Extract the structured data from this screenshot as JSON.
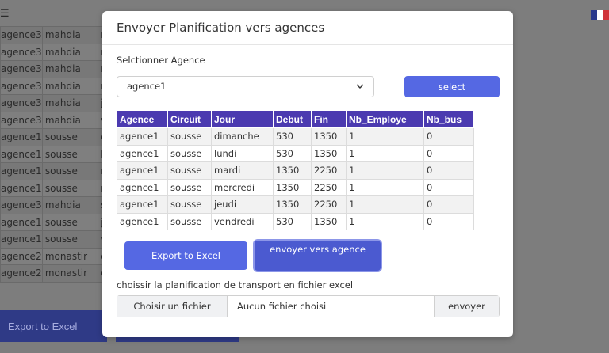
{
  "background": {
    "menu_icon": "hamburger-icon",
    "flag_colors": [
      "#2a3a8c",
      "#ffffff",
      "#d0333a"
    ],
    "table_rows": [
      [
        "agence3",
        "mahdia",
        "r"
      ],
      [
        "agence3",
        "mahdia",
        "m"
      ],
      [
        "agence3",
        "mahdia",
        "r"
      ],
      [
        "agence3",
        "mahdia",
        "r"
      ],
      [
        "agence3",
        "mahdia",
        "je"
      ],
      [
        "agence3",
        "mahdia",
        "v"
      ],
      [
        "agence1",
        "sousse",
        "d"
      ],
      [
        "agence1",
        "sousse",
        "lu"
      ],
      [
        "agence1",
        "sousse",
        "m"
      ],
      [
        "agence1",
        "sousse",
        "m"
      ],
      [
        "agence3",
        "mahdia",
        "s"
      ],
      [
        "agence1",
        "sousse",
        "je"
      ],
      [
        "agence1",
        "sousse",
        "v"
      ],
      [
        "agence2",
        "monastir",
        "d"
      ],
      [
        "agence2",
        "monastir",
        "d"
      ]
    ],
    "export_label": "Export to Excel"
  },
  "modal": {
    "title": "Envoyer Planification vers agences",
    "select_label": "Selctionner Agence",
    "selected_agence": "agence1",
    "select_button": "select",
    "table": {
      "headers": [
        "Agence",
        "Circuit",
        "Jour",
        "Debut",
        "Fin",
        "Nb_Employe",
        "Nb_bus"
      ],
      "rows": [
        [
          "agence1",
          "sousse",
          "dimanche",
          "530",
          "1350",
          "1",
          "0"
        ],
        [
          "agence1",
          "sousse",
          "lundi",
          "530",
          "1350",
          "1",
          "0"
        ],
        [
          "agence1",
          "sousse",
          "mardi",
          "1350",
          "2250",
          "1",
          "0"
        ],
        [
          "agence1",
          "sousse",
          "mercredi",
          "1350",
          "2250",
          "1",
          "0"
        ],
        [
          "agence1",
          "sousse",
          "jeudi",
          "1350",
          "2250",
          "1",
          "0"
        ],
        [
          "agence1",
          "sousse",
          "vendredi",
          "530",
          "1350",
          "1",
          "0"
        ]
      ]
    },
    "export_button": "Export to Excel",
    "send_button": "envoyer vers agence",
    "file_label": "choissir la planification de transport en fichier excel",
    "file_button": "Choisir un fichier",
    "file_placeholder": "Aucun fichier choisi",
    "file_send": "envoyer",
    "accent": "#5568e3",
    "header_color": "#4b3ab0"
  }
}
